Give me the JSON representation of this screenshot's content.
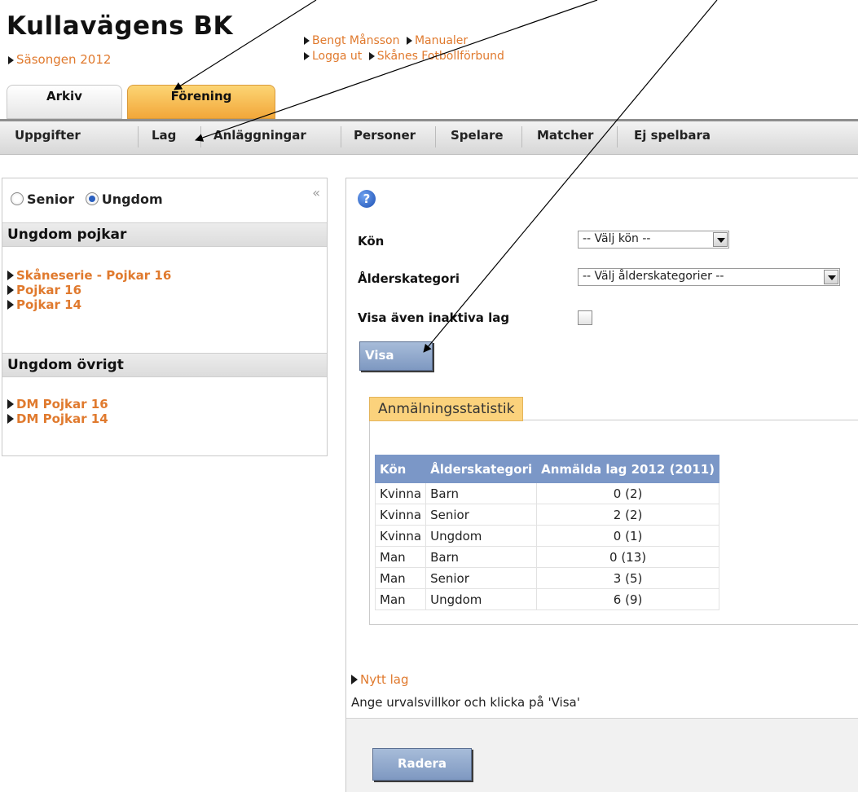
{
  "header": {
    "title": "Kullavägens BK",
    "season": "Säsongen 2012",
    "links": {
      "user": "Bengt Månsson",
      "manuals": "Manualer",
      "logout": "Logga ut",
      "federation": "Skånes Fotbollförbund"
    }
  },
  "tabs": [
    "Arkiv",
    "Förening"
  ],
  "nav": [
    "Uppgifter",
    "Lag",
    "Anläggningar",
    "Personer",
    "Spelare",
    "Matcher",
    "Ej spelbara"
  ],
  "sidebar": {
    "radio_senior": "Senior",
    "radio_ungdom": "Ungdom",
    "selected": "Ungdom",
    "collapse_icon": "«",
    "groups": [
      {
        "title": "Ungdom pojkar",
        "items": [
          "Skåneserie - Pojkar 16",
          "Pojkar 16",
          "Pojkar 14"
        ]
      },
      {
        "title": "Ungdom övrigt",
        "items": [
          "DM Pojkar 16",
          "DM Pojkar 14"
        ]
      }
    ]
  },
  "main": {
    "help_icon": "?",
    "gender_label": "Kön",
    "gender_select": "-- Välj kön --",
    "age_label": "Ålderskategori",
    "age_select": "-- Välj ålderskategorier --",
    "inactive_label": "Visa även inaktiva lag",
    "inactive_checked": false,
    "show_button": "Visa",
    "stats": {
      "legend": "Anmälningsstatistik",
      "headers": [
        "Kön",
        "Ålderskategori",
        "Anmälda lag 2012 (2011)"
      ],
      "rows": [
        [
          "Kvinna",
          "Barn",
          "0 (2)"
        ],
        [
          "Kvinna",
          "Senior",
          "2 (2)"
        ],
        [
          "Kvinna",
          "Ungdom",
          "0 (1)"
        ],
        [
          "Man",
          "Barn",
          "0 (13)"
        ],
        [
          "Man",
          "Senior",
          "3 (5)"
        ],
        [
          "Man",
          "Ungdom",
          "6 (9)"
        ]
      ]
    },
    "new_team_link": "Nytt lag",
    "hint": "Ange urvalsvillkor och klicka på 'Visa'",
    "delete_button": "Radera"
  }
}
